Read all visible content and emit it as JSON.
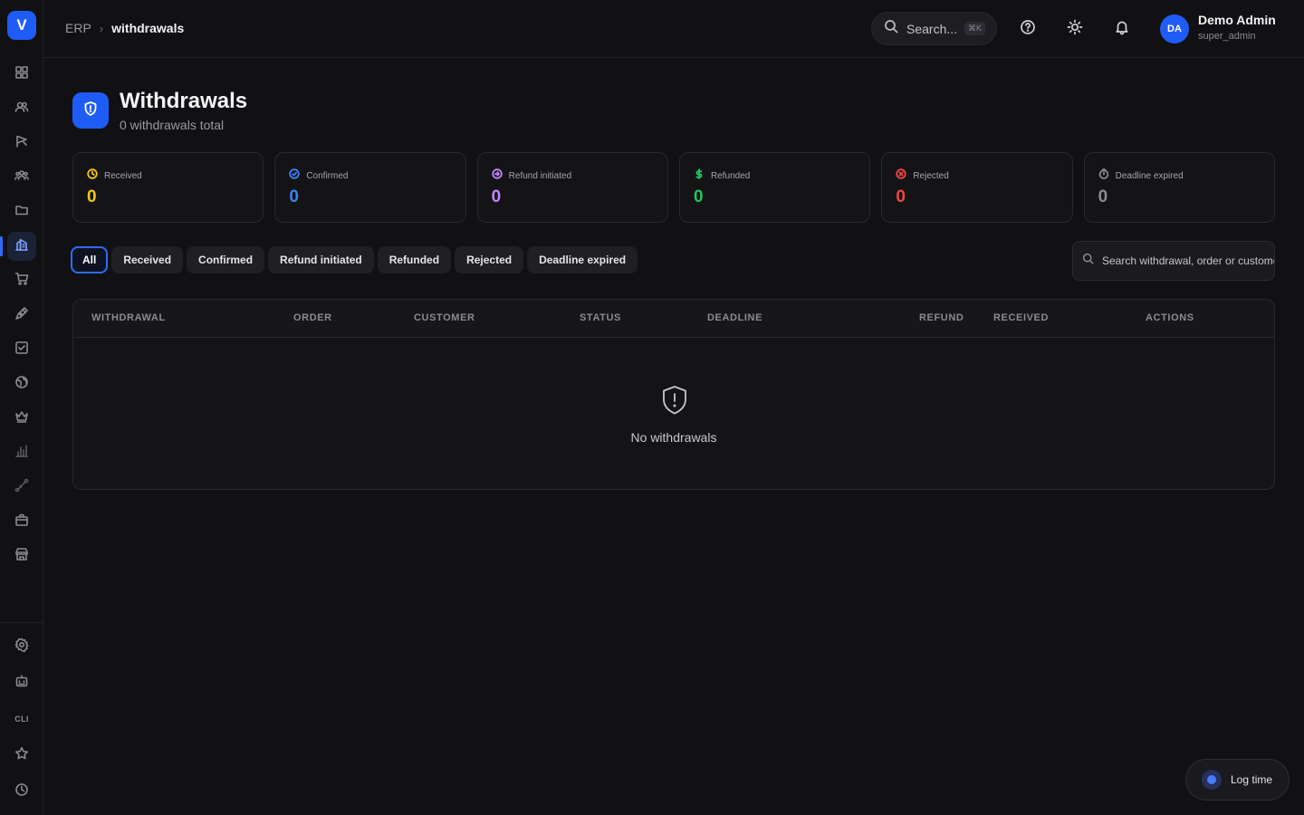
{
  "app": {
    "logo_letter": "V"
  },
  "breadcrumb": {
    "root": "ERP",
    "separator": "›",
    "current": "withdrawals"
  },
  "header": {
    "search_label": "Search...",
    "search_shortcut": "⌘K",
    "user_initials": "DA",
    "user_name": "Demo Admin",
    "user_role": "super_admin"
  },
  "sidebar": {
    "top_items": [
      {
        "name": "dashboard",
        "icon": "grid-icon"
      },
      {
        "name": "users",
        "icon": "users-icon"
      },
      {
        "name": "campaigns",
        "icon": "flag-icon"
      },
      {
        "name": "teams",
        "icon": "team-icon"
      },
      {
        "name": "files",
        "icon": "folder-icon"
      },
      {
        "name": "erp",
        "icon": "bank-icon",
        "active": true
      },
      {
        "name": "shop",
        "icon": "cart-icon"
      },
      {
        "name": "design",
        "icon": "pen-icon"
      },
      {
        "name": "tasks",
        "icon": "checkbox-icon"
      },
      {
        "name": "web",
        "icon": "globe-icon"
      },
      {
        "name": "premium",
        "icon": "crown-icon"
      },
      {
        "name": "analytics",
        "icon": "bar-chart-icon"
      },
      {
        "name": "routes",
        "icon": "route-icon"
      },
      {
        "name": "gifts",
        "icon": "gift-icon"
      },
      {
        "name": "store",
        "icon": "store-icon"
      }
    ],
    "bottom_items": [
      {
        "name": "settings",
        "icon": "gear-icon"
      },
      {
        "name": "bot",
        "icon": "bot-icon"
      },
      {
        "name": "cli",
        "label": "CLI"
      },
      {
        "name": "favorites",
        "icon": "star-icon"
      },
      {
        "name": "history",
        "icon": "clock-icon"
      }
    ]
  },
  "page": {
    "title": "Withdrawals",
    "subtitle": "0 withdrawals total"
  },
  "stats": [
    {
      "label": "Received",
      "value": "0",
      "color": "#f5c518",
      "icon": "clock-icon"
    },
    {
      "label": "Confirmed",
      "value": "0",
      "color": "#3b82f6",
      "icon": "check-circle-icon"
    },
    {
      "label": "Refund initiated",
      "value": "0",
      "color": "#c084fc",
      "icon": "arrow-circle-icon"
    },
    {
      "label": "Refunded",
      "value": "0",
      "color": "#22c55e",
      "icon": "dollar-icon"
    },
    {
      "label": "Rejected",
      "value": "0",
      "color": "#ef4444",
      "icon": "x-circle-icon"
    },
    {
      "label": "Deadline expired",
      "value": "0",
      "color": "#8a8a92",
      "icon": "timer-icon"
    }
  ],
  "filters": {
    "tabs": [
      "All",
      "Received",
      "Confirmed",
      "Refund initiated",
      "Refunded",
      "Rejected",
      "Deadline expired"
    ],
    "active": "All",
    "search_placeholder": "Search withdrawal, order or customer..."
  },
  "table": {
    "columns": [
      "WITHDRAWAL",
      "ORDER",
      "CUSTOMER",
      "STATUS",
      "DEADLINE",
      "REFUND",
      "RECEIVED",
      "ACTIONS"
    ],
    "rows": [],
    "empty_text": "No withdrawals"
  },
  "log_time": {
    "label": "Log time"
  },
  "colors": {
    "accent": "#1f5cf5",
    "background": "#111113"
  }
}
